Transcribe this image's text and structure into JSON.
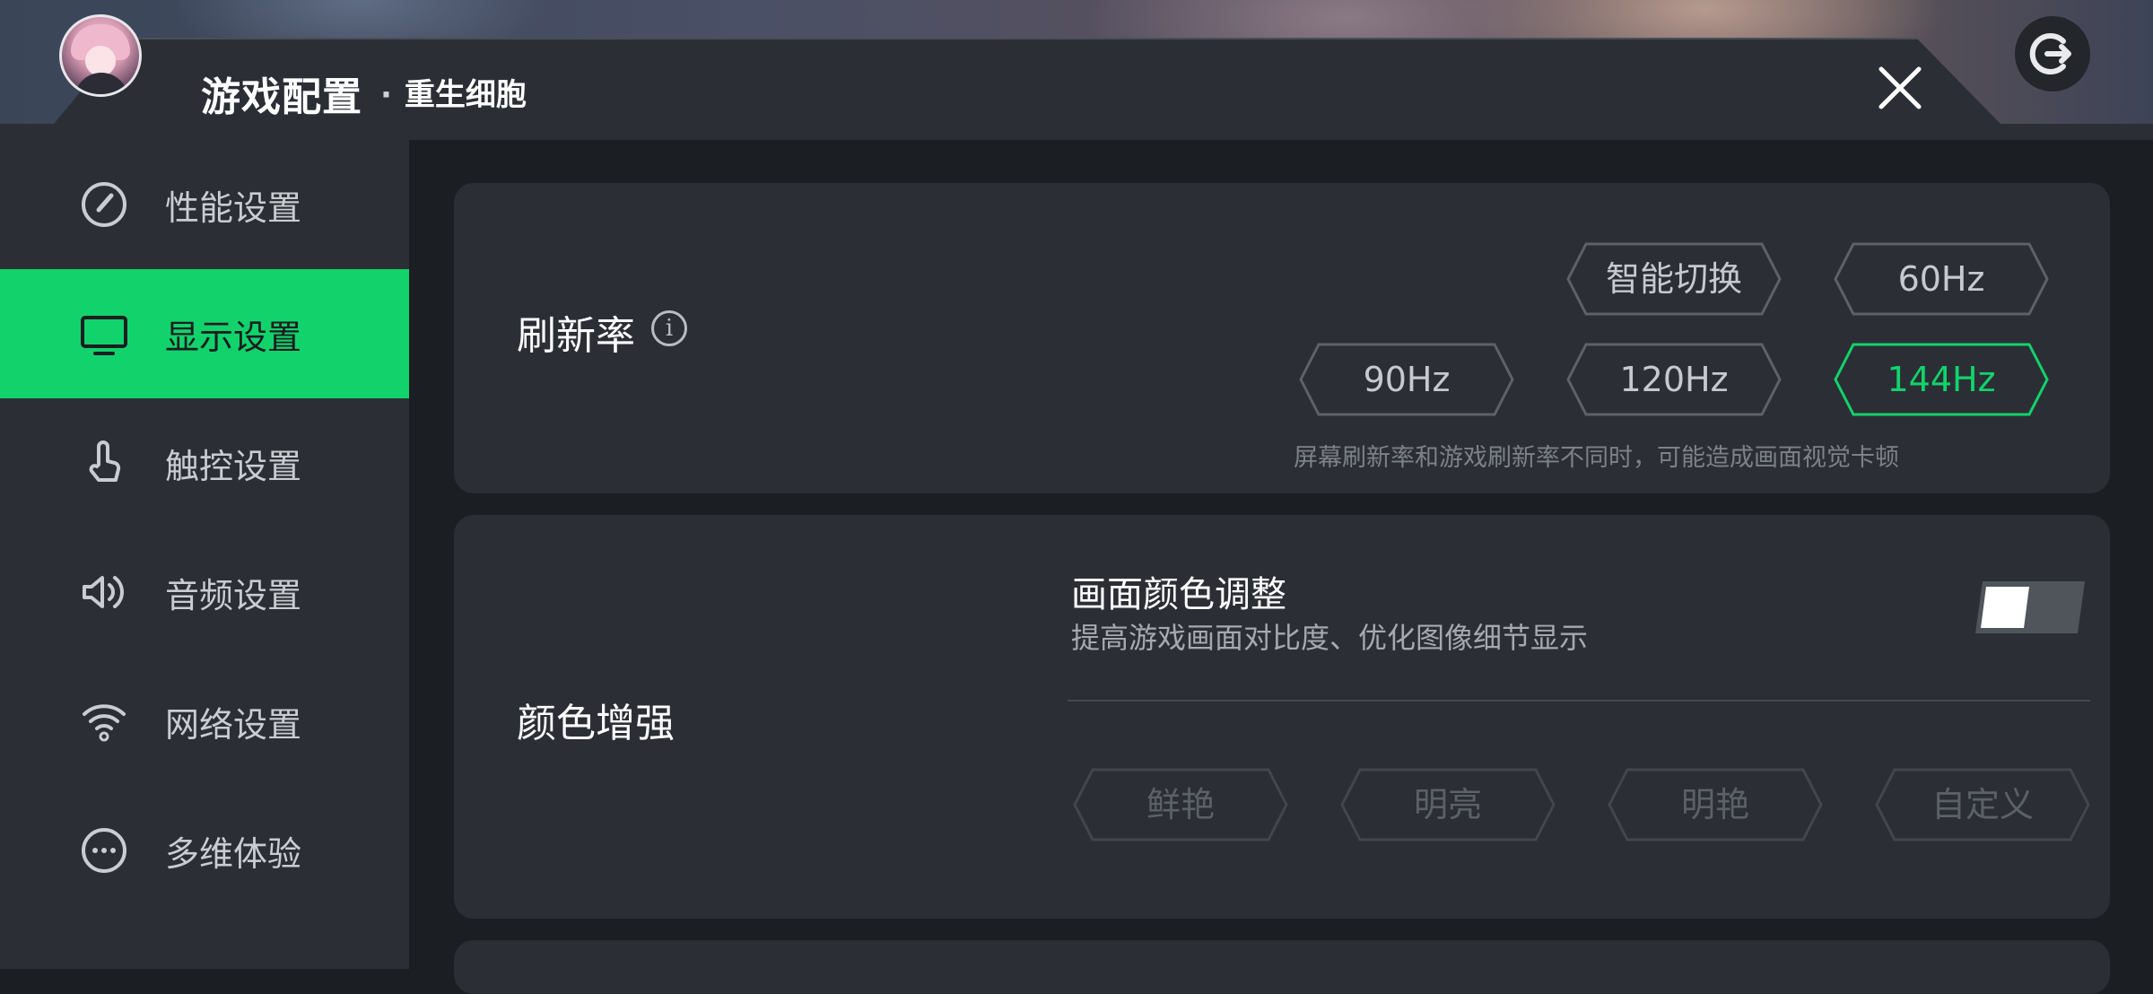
{
  "header": {
    "title": "游戏配置",
    "game_name": "重生细胞",
    "separator": "·"
  },
  "sidebar": {
    "items": [
      {
        "label": "性能设置",
        "icon": "speedometer-icon"
      },
      {
        "label": "显示设置",
        "icon": "monitor-icon",
        "active": true
      },
      {
        "label": "触控设置",
        "icon": "touch-hand-icon"
      },
      {
        "label": "音频设置",
        "icon": "speaker-icon"
      },
      {
        "label": "网络设置",
        "icon": "wifi-icon"
      },
      {
        "label": "多维体验",
        "icon": "more-dots-icon"
      }
    ]
  },
  "refresh_rate": {
    "label": "刷新率",
    "options": [
      "智能切换",
      "60Hz",
      "90Hz",
      "120Hz",
      "144Hz"
    ],
    "selected": "144Hz",
    "note": "屏幕刷新率和游戏刷新率不同时，可能造成画面视觉卡顿"
  },
  "color_enhance": {
    "label": "颜色增强",
    "adjust_title": "画面颜色调整",
    "adjust_desc": "提高游戏画面对比度、优化图像细节显示",
    "toggle_on": false,
    "modes": [
      "鲜艳",
      "明亮",
      "明艳",
      "自定义"
    ]
  },
  "colors": {
    "accent": "#12d36b",
    "panel": "#2b2f35",
    "background": "#1b1e22"
  }
}
